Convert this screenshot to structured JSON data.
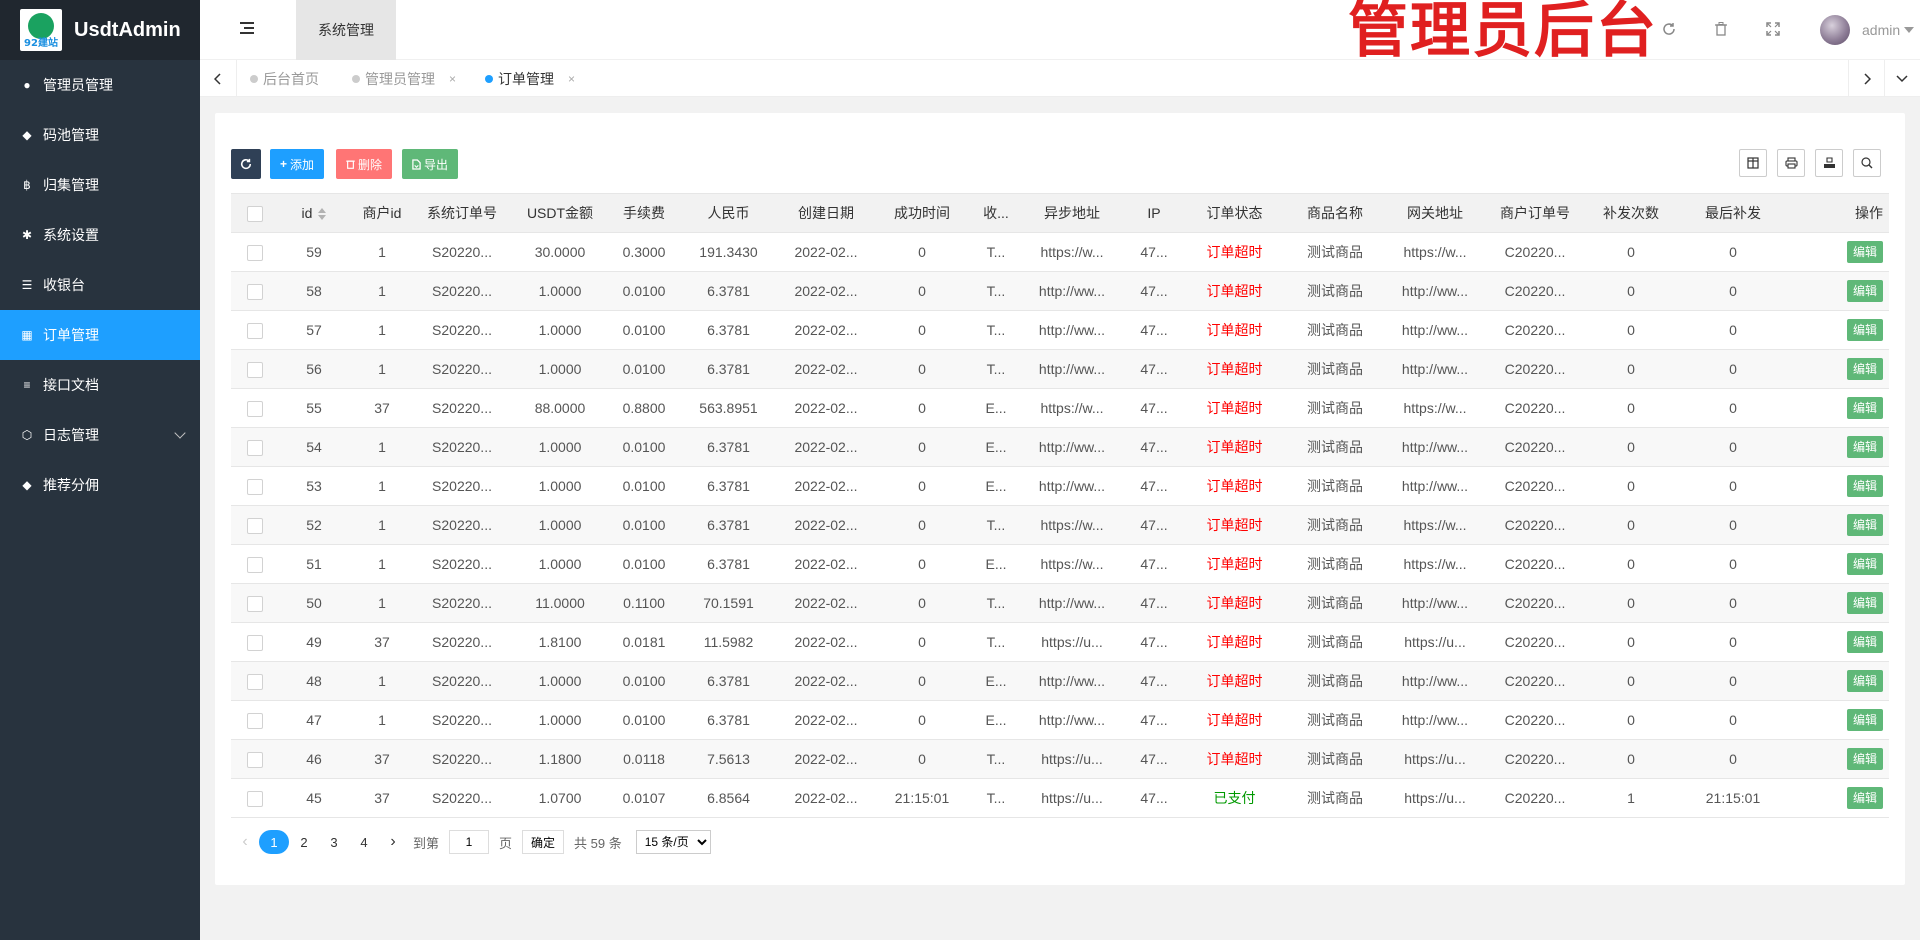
{
  "brand": {
    "title": "UsdtAdmin",
    "logo_text": "92建站"
  },
  "sidebar": {
    "items": [
      {
        "label": "管理员管理",
        "icon": "user-icon"
      },
      {
        "label": "码池管理",
        "icon": "android-icon"
      },
      {
        "label": "归集管理",
        "icon": "bitcoin-icon"
      },
      {
        "label": "系统设置",
        "icon": "gear-icon"
      },
      {
        "label": "收银台",
        "icon": "list-icon"
      },
      {
        "label": "订单管理",
        "icon": "calculator-icon",
        "active": true
      },
      {
        "label": "接口文档",
        "icon": "align-left-icon"
      },
      {
        "label": "日志管理",
        "icon": "cube-icon",
        "has_submenu": true
      },
      {
        "label": "推荐分佣",
        "icon": "android-icon"
      }
    ]
  },
  "header": {
    "tab_label": "系统管理",
    "overlay_title": "管理员后台",
    "user_name": "admin"
  },
  "tabs": [
    {
      "label": "后台首页",
      "closable": false
    },
    {
      "label": "管理员管理",
      "closable": true
    },
    {
      "label": "订单管理",
      "closable": true,
      "active": true
    }
  ],
  "toolbar": {
    "add_label": "添加",
    "delete_label": "删除",
    "export_label": "导出"
  },
  "table": {
    "columns": [
      "id",
      "商户id",
      "系统订单号",
      "USDT金额",
      "手续费",
      "人民币",
      "创建日期",
      "成功时间",
      "收...",
      "异步地址",
      "IP",
      "订单状态",
      "商品名称",
      "网关地址",
      "商户订单号",
      "补发次数",
      "最后补发",
      "操作"
    ],
    "edit_label": "编辑",
    "rows": [
      [
        "59",
        "1",
        "S20220...",
        "30.0000",
        "0.3000",
        "191.3430",
        "2022-02...",
        "0",
        "T...",
        "https://w...",
        "47...",
        "订单超时",
        "测试商品",
        "https://w...",
        "C20220...",
        "0",
        "0"
      ],
      [
        "58",
        "1",
        "S20220...",
        "1.0000",
        "0.0100",
        "6.3781",
        "2022-02...",
        "0",
        "T...",
        "http://ww...",
        "47...",
        "订单超时",
        "测试商品",
        "http://ww...",
        "C20220...",
        "0",
        "0"
      ],
      [
        "57",
        "1",
        "S20220...",
        "1.0000",
        "0.0100",
        "6.3781",
        "2022-02...",
        "0",
        "T...",
        "http://ww...",
        "47...",
        "订单超时",
        "测试商品",
        "http://ww...",
        "C20220...",
        "0",
        "0"
      ],
      [
        "56",
        "1",
        "S20220...",
        "1.0000",
        "0.0100",
        "6.3781",
        "2022-02...",
        "0",
        "T...",
        "http://ww...",
        "47...",
        "订单超时",
        "测试商品",
        "http://ww...",
        "C20220...",
        "0",
        "0"
      ],
      [
        "55",
        "37",
        "S20220...",
        "88.0000",
        "0.8800",
        "563.8951",
        "2022-02...",
        "0",
        "E...",
        "https://w...",
        "47...",
        "订单超时",
        "测试商品",
        "https://w...",
        "C20220...",
        "0",
        "0"
      ],
      [
        "54",
        "1",
        "S20220...",
        "1.0000",
        "0.0100",
        "6.3781",
        "2022-02...",
        "0",
        "E...",
        "http://ww...",
        "47...",
        "订单超时",
        "测试商品",
        "http://ww...",
        "C20220...",
        "0",
        "0"
      ],
      [
        "53",
        "1",
        "S20220...",
        "1.0000",
        "0.0100",
        "6.3781",
        "2022-02...",
        "0",
        "E...",
        "http://ww...",
        "47...",
        "订单超时",
        "测试商品",
        "http://ww...",
        "C20220...",
        "0",
        "0"
      ],
      [
        "52",
        "1",
        "S20220...",
        "1.0000",
        "0.0100",
        "6.3781",
        "2022-02...",
        "0",
        "T...",
        "https://w...",
        "47...",
        "订单超时",
        "测试商品",
        "https://w...",
        "C20220...",
        "0",
        "0"
      ],
      [
        "51",
        "1",
        "S20220...",
        "1.0000",
        "0.0100",
        "6.3781",
        "2022-02...",
        "0",
        "E...",
        "https://w...",
        "47...",
        "订单超时",
        "测试商品",
        "https://w...",
        "C20220...",
        "0",
        "0"
      ],
      [
        "50",
        "1",
        "S20220...",
        "11.0000",
        "0.1100",
        "70.1591",
        "2022-02...",
        "0",
        "T...",
        "http://ww...",
        "47...",
        "订单超时",
        "测试商品",
        "http://ww...",
        "C20220...",
        "0",
        "0"
      ],
      [
        "49",
        "37",
        "S20220...",
        "1.8100",
        "0.0181",
        "11.5982",
        "2022-02...",
        "0",
        "T...",
        "https://u...",
        "47...",
        "订单超时",
        "测试商品",
        "https://u...",
        "C20220...",
        "0",
        "0"
      ],
      [
        "48",
        "1",
        "S20220...",
        "1.0000",
        "0.0100",
        "6.3781",
        "2022-02...",
        "0",
        "E...",
        "http://ww...",
        "47...",
        "订单超时",
        "测试商品",
        "http://ww...",
        "C20220...",
        "0",
        "0"
      ],
      [
        "47",
        "1",
        "S20220...",
        "1.0000",
        "0.0100",
        "6.3781",
        "2022-02...",
        "0",
        "E...",
        "http://ww...",
        "47...",
        "订单超时",
        "测试商品",
        "http://ww...",
        "C20220...",
        "0",
        "0"
      ],
      [
        "46",
        "37",
        "S20220...",
        "1.1800",
        "0.0118",
        "7.5613",
        "2022-02...",
        "0",
        "T...",
        "https://u...",
        "47...",
        "订单超时",
        "测试商品",
        "https://u...",
        "C20220...",
        "0",
        "0"
      ],
      [
        "45",
        "37",
        "S20220...",
        "1.0700",
        "0.0107",
        "6.8564",
        "2022-02...",
        "21:15:01",
        "T...",
        "https://u...",
        "47...",
        "已支付",
        "测试商品",
        "https://u...",
        "C20220...",
        "1",
        "21:15:01"
      ]
    ]
  },
  "pagination": {
    "pages": [
      "1",
      "2",
      "3",
      "4"
    ],
    "current": "1",
    "goto_label": "到第",
    "page_unit": "页",
    "goto_value": "1",
    "confirm_label": "确定",
    "total_text": "共 59 条",
    "page_size": "15 条/页"
  },
  "colors": {
    "sidebar_bg": "#28333e",
    "active": "#1e9fff",
    "timeout": "#ff0000",
    "paid": "#009900",
    "edit": "#5fb878"
  }
}
